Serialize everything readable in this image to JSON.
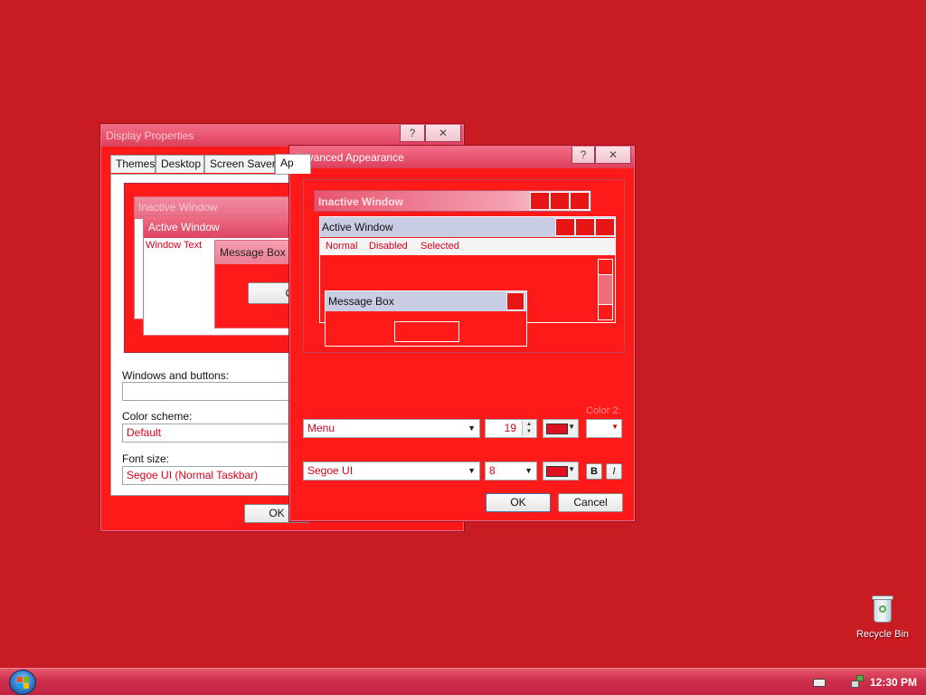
{
  "desktop": {
    "background": "#c81c22",
    "recycle_bin_label": "Recycle Bin"
  },
  "display_properties": {
    "title": "Display Properties",
    "help_glyph": "?",
    "close_glyph": "✕",
    "tabs": [
      "Themes",
      "Desktop",
      "Screen Saver",
      "Ap"
    ],
    "preview": {
      "inactive_window": "Inactive Window",
      "active_window": "Active Window",
      "window_text": "Window Text",
      "message_box": "Message Box",
      "ok": "OK"
    },
    "windows_and_buttons_label": "Windows and buttons:",
    "windows_and_buttons_value": "",
    "color_scheme_label": "Color scheme:",
    "color_scheme_value": "Default",
    "font_size_label": "Font size:",
    "font_size_value": "Segoe UI (Normal Taskbar)",
    "ok_button": "OK"
  },
  "advanced_appearance": {
    "title": "Advanced Appearance",
    "help_glyph": "?",
    "close_glyph": "✕",
    "preview": {
      "inactive_window": "Inactive Window",
      "active_window": "Active Window",
      "menu_normal": "Normal",
      "menu_disabled": "Disabled",
      "menu_selected": "Selected",
      "message_box": "Message Box"
    },
    "item_value": "Menu",
    "size_value": "19",
    "color2_label": "Color 2:",
    "font_value": "Segoe UI",
    "font_size_value": "8",
    "bold_label": "B",
    "italic_label": "I",
    "ok_button": "OK",
    "cancel_button": "Cancel"
  },
  "taskbar": {
    "time": "12:30 PM",
    "start_icon": "windows-orb-icon",
    "tray_icons": [
      "keyboard-icon",
      "network-icon"
    ]
  },
  "colors": {
    "window_face": "#ff1a1a",
    "title_gradient_top": "#f26d87",
    "title_gradient_bottom": "#dc3f5c",
    "text_red": "#d9001b"
  }
}
